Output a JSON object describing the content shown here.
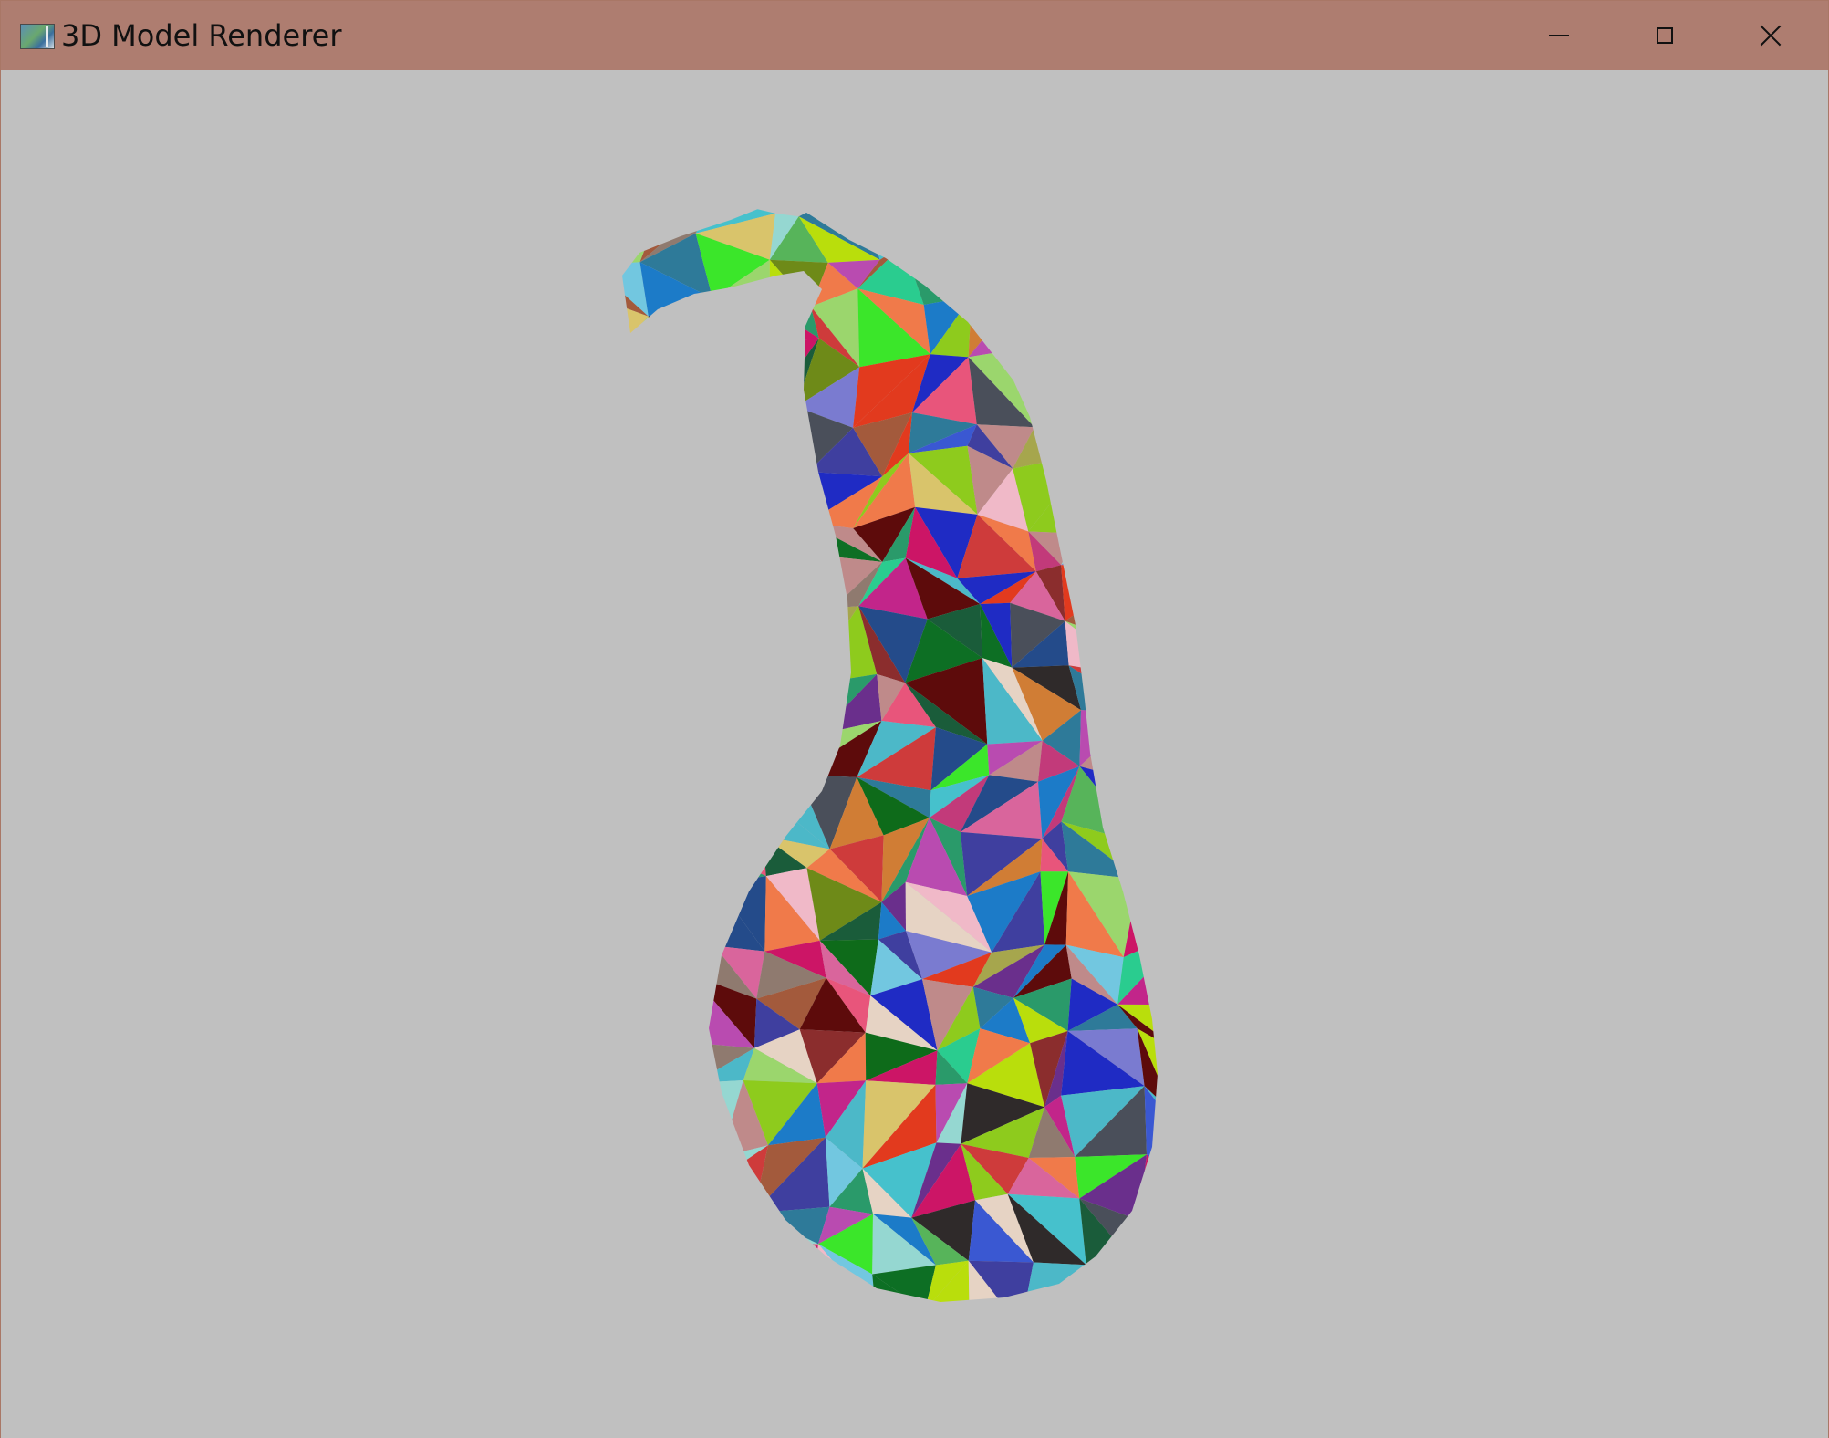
{
  "window": {
    "title": "3D Model Renderer",
    "icon": "app-window-icon",
    "controls": {
      "minimize_icon": "minimize-icon",
      "maximize_icon": "maximize-icon",
      "close_icon": "close-icon"
    }
  },
  "colors": {
    "titlebar": "#ae7d70",
    "background": "#c0c0c0"
  },
  "scene": {
    "model": "gourd",
    "shading": "flat random colors per triangle"
  }
}
